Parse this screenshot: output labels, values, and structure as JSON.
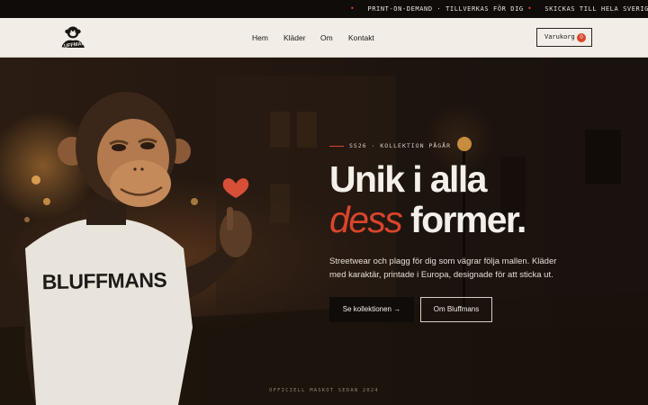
{
  "announcement": {
    "items": [
      "PRINT-ON-DEMAND · TILLVERKAS FÖR DIG",
      "SKICKAS TILL HELA SVERIGE"
    ]
  },
  "header": {
    "logo_text": "BLUFFMANS",
    "nav": [
      "Hem",
      "Kläder",
      "Om",
      "Kontakt"
    ],
    "cart_label": "Varukorg",
    "cart_count": "0"
  },
  "hero": {
    "eyebrow": "SS26 · KOLLEKTION PÅGÅR",
    "headline_line1": "Unik i alla",
    "headline_accent": "dess",
    "headline_rest": "former.",
    "subtext": "Streetwear och plagg för dig som vägrar följa mallen. Kläder med karaktär, printade i Europa, designade för att sticka ut.",
    "primary_cta": "Se kollektionen →",
    "secondary_cta": "Om Bluffmans",
    "shirt_print": "BLUFFMANS",
    "mascot_caption": "OFFICIELL MASKOT SEDAN 2024"
  },
  "colors": {
    "accent": "#d9452b",
    "header_bg": "#f2eee7",
    "topbar_bg": "#0f0c0a"
  }
}
